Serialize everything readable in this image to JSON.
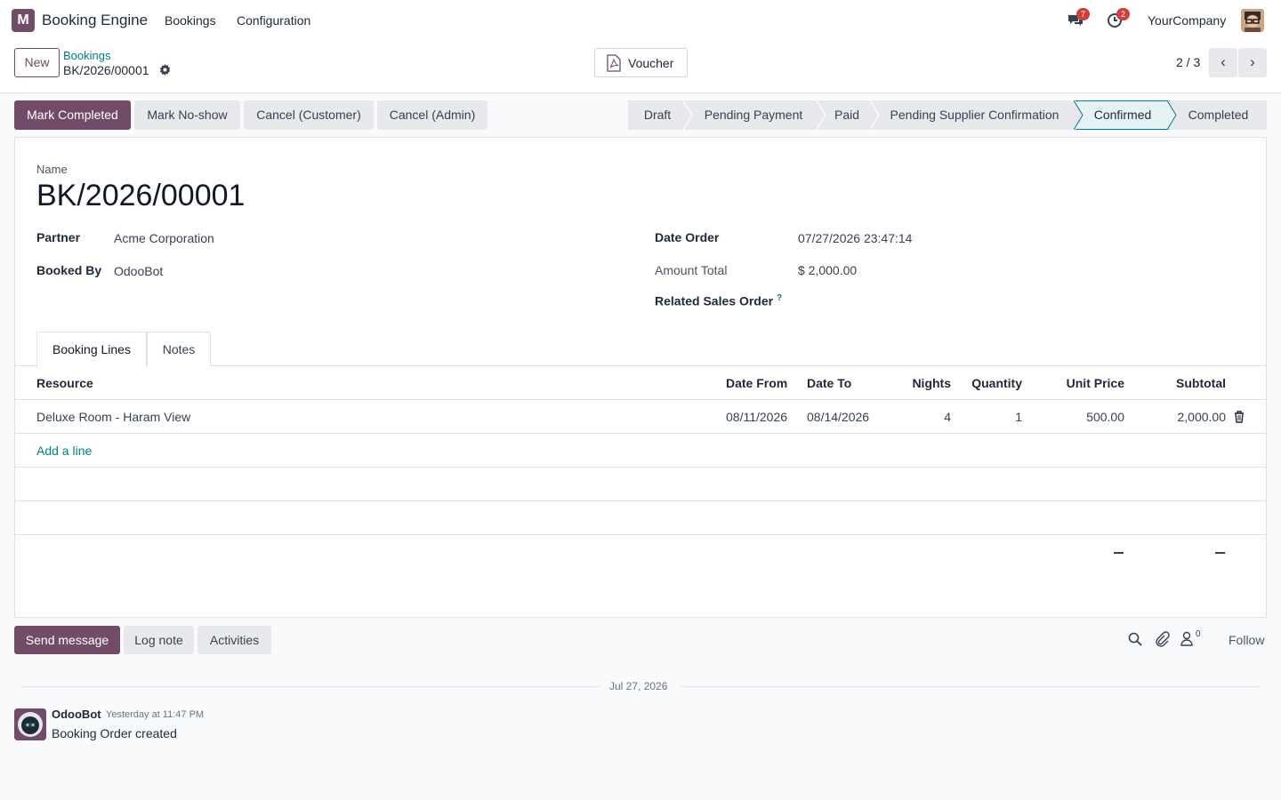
{
  "app": {
    "logo_letter": "M",
    "name": "Booking Engine",
    "brand_color": "#714b67",
    "link_color": "#017e84"
  },
  "topnav": {
    "items": [
      "Bookings",
      "Configuration"
    ]
  },
  "systray": {
    "messages_icon": "chat-bubbles-icon",
    "messages_count": "7",
    "activities_icon": "clock-icon",
    "activities_count": "2",
    "company": "YourCompany"
  },
  "controlpanel": {
    "new_label": "New",
    "breadcrumb_parent": "Bookings",
    "breadcrumb_current": "BK/2026/00001",
    "voucher_label": "Voucher",
    "pager": "2 / 3"
  },
  "actions": [
    "Mark Completed",
    "Mark No-show",
    "Cancel (Customer)",
    "Cancel (Admin)"
  ],
  "statusbar": {
    "stages": [
      "Draft",
      "Pending Payment",
      "Paid",
      "Pending Supplier Confirmation",
      "Confirmed",
      "Completed"
    ],
    "active": "Confirmed"
  },
  "form": {
    "name_label": "Name",
    "name": "BK/2026/00001",
    "partner_label": "Partner",
    "partner": "Acme Corporation",
    "booked_by_label": "Booked By",
    "booked_by": "OdooBot",
    "date_order_label": "Date Order",
    "date_order": "07/27/2026 23:47:14",
    "amount_total_label": "Amount Total",
    "amount_total": "$ 2,000.00",
    "related_so_label": "Related Sales Order",
    "related_so_help": "?"
  },
  "tabs": [
    "Booking Lines",
    "Notes"
  ],
  "lines": {
    "headers": {
      "resource": "Resource",
      "date_from": "Date From",
      "date_to": "Date To",
      "nights": "Nights",
      "quantity": "Quantity",
      "unit_price": "Unit Price",
      "subtotal": "Subtotal"
    },
    "rows": [
      {
        "resource": "Deluxe Room - Haram View",
        "date_from": "08/11/2026",
        "date_to": "08/14/2026",
        "nights": "4",
        "quantity": "1",
        "unit_price": "500.00",
        "subtotal": "2,000.00"
      }
    ],
    "add_line": "Add a line"
  },
  "chatter": {
    "send_message": "Send message",
    "log_note": "Log note",
    "activities": "Activities",
    "followers_count": "0",
    "follow": "Follow",
    "date_separator": "Jul 27, 2026",
    "messages": [
      {
        "author": "OdooBot",
        "time": "Yesterday at 11:47 PM",
        "body": "Booking Order created"
      }
    ]
  }
}
